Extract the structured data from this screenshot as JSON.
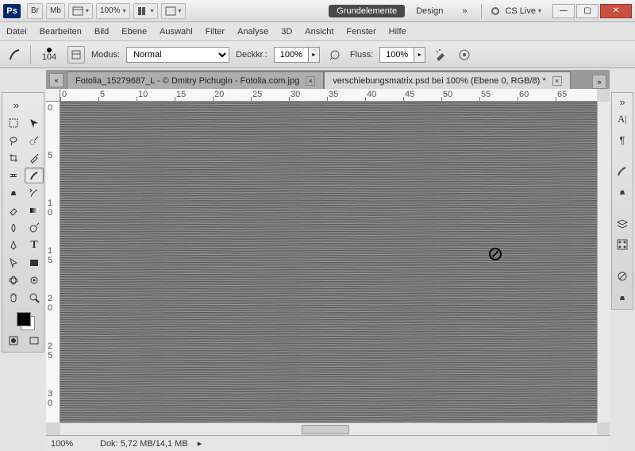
{
  "app": {
    "logo": "Ps"
  },
  "titlebar": {
    "br": "Br",
    "mb": "Mb",
    "zoom": "100%",
    "workspace_active": "Grundelemente",
    "workspace_other": "Design",
    "cslive": "CS Live"
  },
  "menu": [
    "Datei",
    "Bearbeiten",
    "Bild",
    "Ebene",
    "Auswahl",
    "Filter",
    "Analyse",
    "3D",
    "Ansicht",
    "Fenster",
    "Hilfe"
  ],
  "options": {
    "brush_size": "104",
    "mode_label": "Modus:",
    "mode_value": "Normal",
    "opacity_label": "Deckkr.:",
    "opacity_value": "100%",
    "flow_label": "Fluss:",
    "flow_value": "100%"
  },
  "tabs": [
    {
      "title": "Fotolia_15279687_L - © Dmitry Pichugin - Fotolia.com.jpg",
      "active": false
    },
    {
      "title": "verschiebungsmatrix.psd bei 100% (Ebene 0, RGB/8) *",
      "active": true
    }
  ],
  "ruler_h": [
    0,
    5,
    10,
    15,
    20,
    25,
    30,
    35,
    40,
    45,
    50,
    55,
    60,
    65
  ],
  "ruler_v": [
    0,
    5,
    "1\n0",
    "1\n5",
    "2\n0",
    "2\n5",
    "3\n0"
  ],
  "status": {
    "zoom": "100%",
    "doc_label": "Dok:",
    "doc_size": "5,72 MB/14,1 MB"
  }
}
